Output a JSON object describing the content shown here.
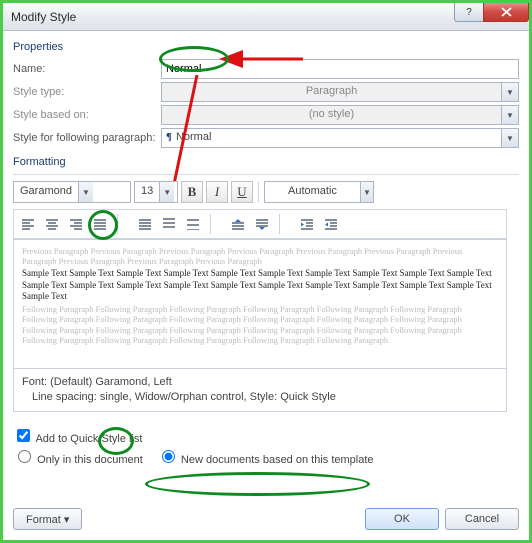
{
  "window": {
    "title": "Modify Style"
  },
  "properties": {
    "heading": "Properties",
    "name_label": "Name:",
    "name_value": "Normal",
    "type_label": "Style type:",
    "type_value": "Paragraph",
    "based_label": "Style based on:",
    "based_value": "(no style)",
    "following_label": "Style for following paragraph:",
    "following_value": "Normal"
  },
  "formatting": {
    "heading": "Formatting",
    "font_name": "Garamond",
    "font_size": "13",
    "bold": "B",
    "italic": "I",
    "underline": "U",
    "color": "Automatic"
  },
  "preview": {
    "ghost_prev": "Previous Paragraph Previous Paragraph Previous Paragraph Previous Paragraph Previous Paragraph Previous Paragraph Previous Paragraph Previous Paragraph Previous Paragraph Previous Paragraph",
    "sample": "Sample Text Sample Text Sample Text Sample Text Sample Text Sample Text Sample Text Sample Text Sample Text Sample Text Sample Text Sample Text Sample Text Sample Text Sample Text Sample Text Sample Text Sample Text Sample Text Sample Text Sample Text",
    "ghost_next": "Following Paragraph Following Paragraph Following Paragraph Following Paragraph Following Paragraph Following Paragraph Following Paragraph Following Paragraph Following Paragraph Following Paragraph Following Paragraph Following Paragraph Following Paragraph Following Paragraph Following Paragraph Following Paragraph Following Paragraph Following Paragraph Following Paragraph Following Paragraph Following Paragraph Following Paragraph Following Paragraph"
  },
  "summary": {
    "line1": "Font: (Default) Garamond, Left",
    "line2": "Line spacing:  single, Widow/Orphan control, Style: Quick Style"
  },
  "footer": {
    "add_quick": "Add to Quick Style list",
    "only_doc": "Only in this document",
    "new_docs": "New documents based on this template",
    "format_btn": "Format ▾",
    "ok": "OK",
    "cancel": "Cancel"
  }
}
